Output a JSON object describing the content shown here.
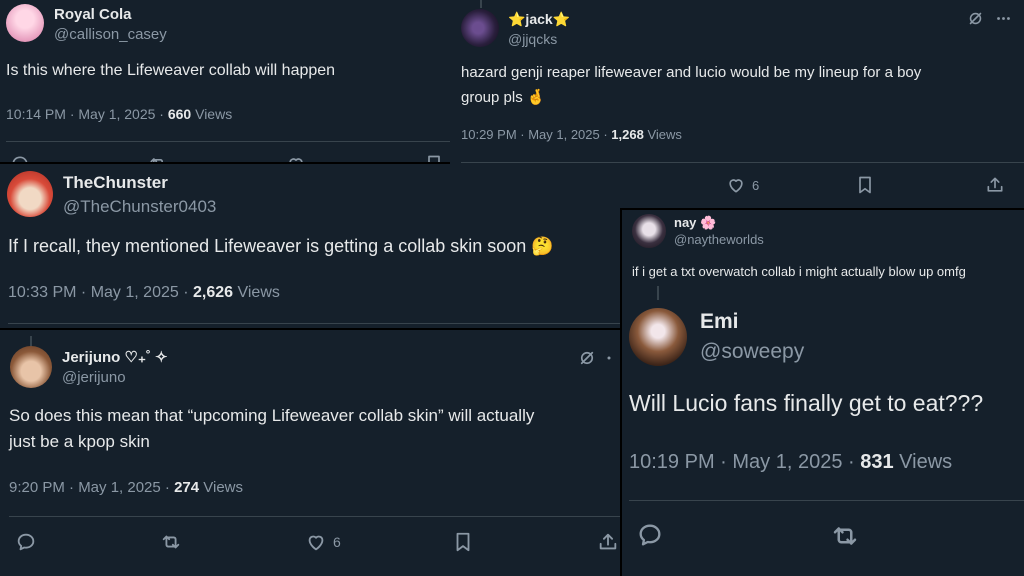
{
  "tweets": {
    "royal": {
      "name": "Royal Cola",
      "handle": "@callison_casey",
      "text": "Is this where the Lifeweaver collab will happen",
      "time": "10:14 PM · May 1, 2025 · ",
      "views": "660",
      "views_label": " Views"
    },
    "jack": {
      "name": "⭐jack⭐",
      "handle": "@jjqcks",
      "text1": "hazard genji reaper lifeweaver and lucio would be my lineup for a boy",
      "text2": "group pls 🤞",
      "time": "10:29 PM · May 1, 2025 · ",
      "views": "1,268",
      "views_label": " Views",
      "likes": "6"
    },
    "chunster": {
      "name": "TheChunster",
      "handle": "@TheChunster0403",
      "text": "If I recall, they mentioned Lifeweaver is getting a collab skin soon 🤔",
      "time": "10:33 PM · May 1, 2025 · ",
      "views": "2,626",
      "views_label": " Views"
    },
    "nay": {
      "name": "nay 🌸",
      "handle": "@naytheworlds",
      "text": "if i get a txt overwatch collab i might actually blow up omfg"
    },
    "jerijuno": {
      "name": "Jerijuno ♡₊˚ ✧",
      "handle": "@jerijuno",
      "text1": "So does this mean that “upcoming Lifeweaver collab skin” will actually",
      "text2": "just be a kpop skin",
      "time": "9:20 PM · May 1, 2025 · ",
      "views": "274",
      "views_label": " Views",
      "likes": "6"
    },
    "emi": {
      "name": "Emi",
      "handle": "@soweepy",
      "text": "Will Lucio fans finally get to eat???",
      "time": "10:19 PM · May 1, 2025 · ",
      "views": "831",
      "views_label": " Views"
    }
  },
  "icons": [
    "reply-icon",
    "retweet-icon",
    "like-icon",
    "bookmark-icon",
    "share-icon",
    "grok-icon",
    "more-icon"
  ],
  "colors": {
    "background": "#15202b",
    "text": "#e7e9ea",
    "secondary": "#8b98a5",
    "divider": "#38444d"
  }
}
